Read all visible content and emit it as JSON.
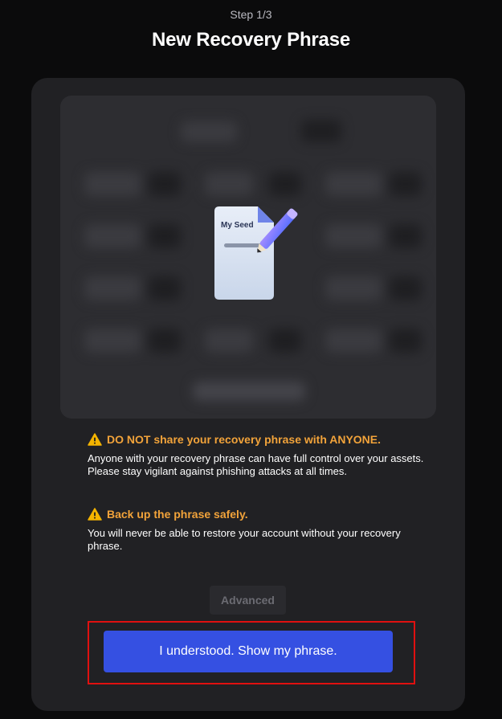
{
  "header": {
    "step": "Step 1/3",
    "title": "New Recovery Phrase"
  },
  "preview": {
    "icon_name": "seed-document-pencil-icon",
    "icon_label": "My Seed"
  },
  "warnings": [
    {
      "icon": "warning-triangle-icon",
      "title": "DO NOT share your recovery phrase with ANYONE.",
      "body": "Anyone with your recovery phrase can have full control over your assets. Please stay vigilant against phishing attacks at all times."
    },
    {
      "icon": "warning-triangle-icon",
      "title": "Back up the phrase safely.",
      "body": "You will never be able to restore your account without your recovery phrase."
    }
  ],
  "actions": {
    "advanced_label": "Advanced",
    "primary_label": "I understood. Show my phrase."
  },
  "colors": {
    "background": "#0b0b0c",
    "card": "#212124",
    "warning": "#f2a33a",
    "primary": "#3550e2",
    "highlight": "#e01010"
  }
}
